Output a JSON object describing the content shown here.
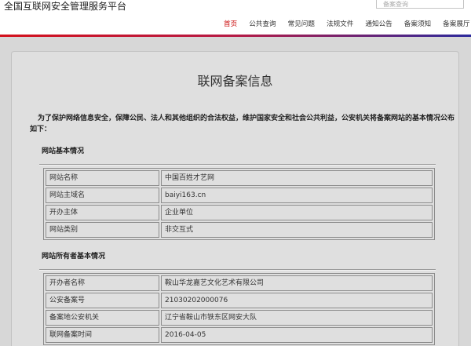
{
  "header": {
    "site_title": "全国互联网安全管理服务平台",
    "search_placeholder": "备案查询"
  },
  "nav": [
    {
      "label": "首页",
      "active": true
    },
    {
      "label": "公共查询"
    },
    {
      "label": "常见问题"
    },
    {
      "label": "法规文件"
    },
    {
      "label": "通知公告"
    },
    {
      "label": "备案须知"
    },
    {
      "label": "备案展厅"
    }
  ],
  "colors": {
    "nav_active": "#cc1111",
    "rule_start": "#d3111c",
    "rule_end": "#2c2a9c"
  },
  "record": {
    "title": "联网备案信息",
    "intro": "为了保护网络信息安全，保障公民、法人和其他组织的合法权益，维护国家安全和社会公共利益，公安机关将备案网站的基本情况公布如下：",
    "sections": [
      {
        "heading": "网站基本情况",
        "rows": [
          {
            "label": "网站名称",
            "value": "中国百姓才艺网"
          },
          {
            "label": "网站主域名",
            "value": "baiyi163.cn"
          },
          {
            "label": "开办主体",
            "value": "企业单位"
          },
          {
            "label": "网站类别",
            "value": "非交互式"
          }
        ]
      },
      {
        "heading": "网站所有者基本情况",
        "rows": [
          {
            "label": "开办者名称",
            "value": "鞍山华龙嘉艺文化艺术有限公司"
          },
          {
            "label": "公安备案号",
            "value": "21030202000076"
          },
          {
            "label": "备案地公安机关",
            "value": "辽宁省鞍山市铁东区网安大队"
          },
          {
            "label": "联网备案时间",
            "value": "2016-04-05"
          }
        ]
      }
    ]
  }
}
